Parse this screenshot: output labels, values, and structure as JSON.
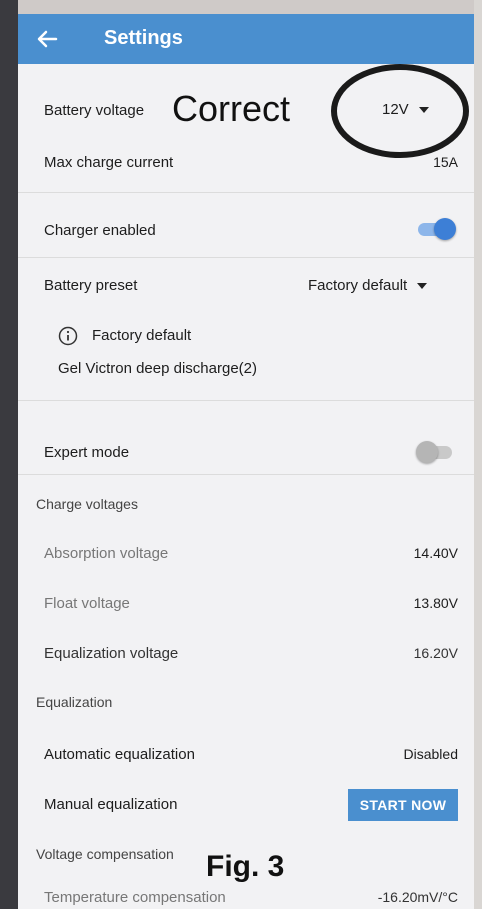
{
  "app": {
    "title": "Settings"
  },
  "settings": {
    "battery_voltage": {
      "label": "Battery voltage",
      "value": "12V"
    },
    "max_charge_current": {
      "label": "Max charge current",
      "value": "15A"
    },
    "charger_enabled": {
      "label": "Charger enabled",
      "enabled": true
    },
    "battery_preset": {
      "label": "Battery preset",
      "value": "Factory default"
    },
    "preset_info": {
      "title": "Factory default",
      "subtitle": "Gel Victron deep discharge(2)"
    },
    "expert_mode": {
      "label": "Expert mode",
      "enabled": false
    },
    "charge_voltages": {
      "heading": "Charge voltages",
      "absorption": {
        "label": "Absorption voltage",
        "value": "14.40V"
      },
      "float": {
        "label": "Float voltage",
        "value": "13.80V"
      },
      "equalization": {
        "label": "Equalization voltage",
        "value": "16.20V"
      }
    },
    "equalization": {
      "heading": "Equalization",
      "automatic": {
        "label": "Automatic equalization",
        "value": "Disabled"
      },
      "manual": {
        "label": "Manual equalization",
        "button": "START NOW"
      }
    },
    "voltage_compensation": {
      "heading": "Voltage compensation",
      "temperature": {
        "label": "Temperature compensation",
        "value": "-16.20mV/°C"
      }
    }
  },
  "annotations": {
    "correct": "Correct",
    "figure": "Fig. 3"
  },
  "colors": {
    "accent": "#4a8fcf",
    "toggle_on": "#3d7fd6",
    "toggle_off": "#b5b5b5",
    "background": "#f2f2f4"
  },
  "icons": {
    "back": "arrow-left-icon",
    "dropdown": "chevron-down-icon",
    "info": "info-circle-icon"
  }
}
